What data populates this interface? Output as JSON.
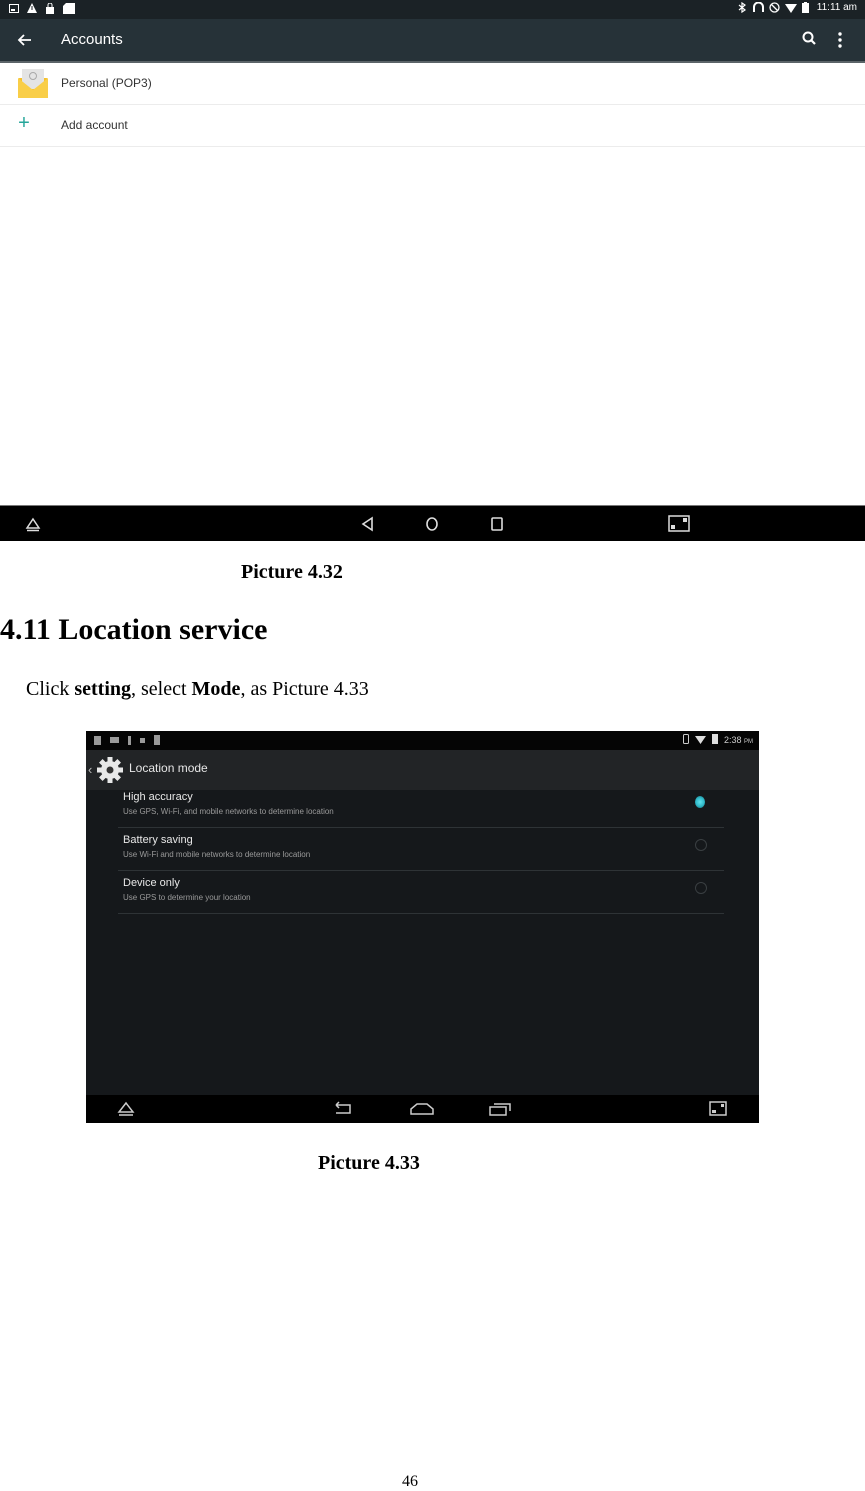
{
  "screenshot1": {
    "status_bar": {
      "left_icons": [
        "screenshot-icon",
        "warning-icon",
        "lock-icon",
        "sd-card-icon"
      ],
      "right_icons": [
        "bluetooth-icon",
        "headset-icon",
        "do-not-disturb-icon",
        "wifi-icon",
        "battery-icon"
      ],
      "time": "11:11 am"
    },
    "toolbar": {
      "title": "Accounts",
      "back_icon": "arrow-back-icon",
      "search_icon": "search-icon",
      "more_icon": "more-vert-icon"
    },
    "accounts": [
      {
        "label": "Personal (POP3)",
        "icon": "email-icon"
      },
      {
        "label": "Add account",
        "icon": "plus-icon"
      }
    ],
    "nav_bar": [
      "up-icon",
      "back-icon",
      "home-icon",
      "recents-icon",
      "screen-shot-icon"
    ]
  },
  "doc": {
    "caption1": "Picture 4.32",
    "heading": "4.11 Location service",
    "para": {
      "p1": "Click ",
      "b1": "setting",
      "p2": ", select ",
      "b2": "Mode",
      "p3": ", as Picture 4.33"
    },
    "caption2": "Picture 4.33",
    "page_number": "46"
  },
  "screenshot2": {
    "status_bar": {
      "time": "2:38",
      "ampm": "PM"
    },
    "action_bar": {
      "title": "Location mode"
    },
    "modes": [
      {
        "title": "High accuracy",
        "subtitle": "Use GPS, Wi-Fi, and mobile networks to determine location",
        "selected": true
      },
      {
        "title": "Battery saving",
        "subtitle": "Use Wi-Fi and mobile networks to determine location",
        "selected": false
      },
      {
        "title": "Device only",
        "subtitle": "Use GPS to determine your location",
        "selected": false
      }
    ],
    "colors": {
      "selected_radio": "#2fb7c7",
      "background": "#15181b"
    }
  }
}
